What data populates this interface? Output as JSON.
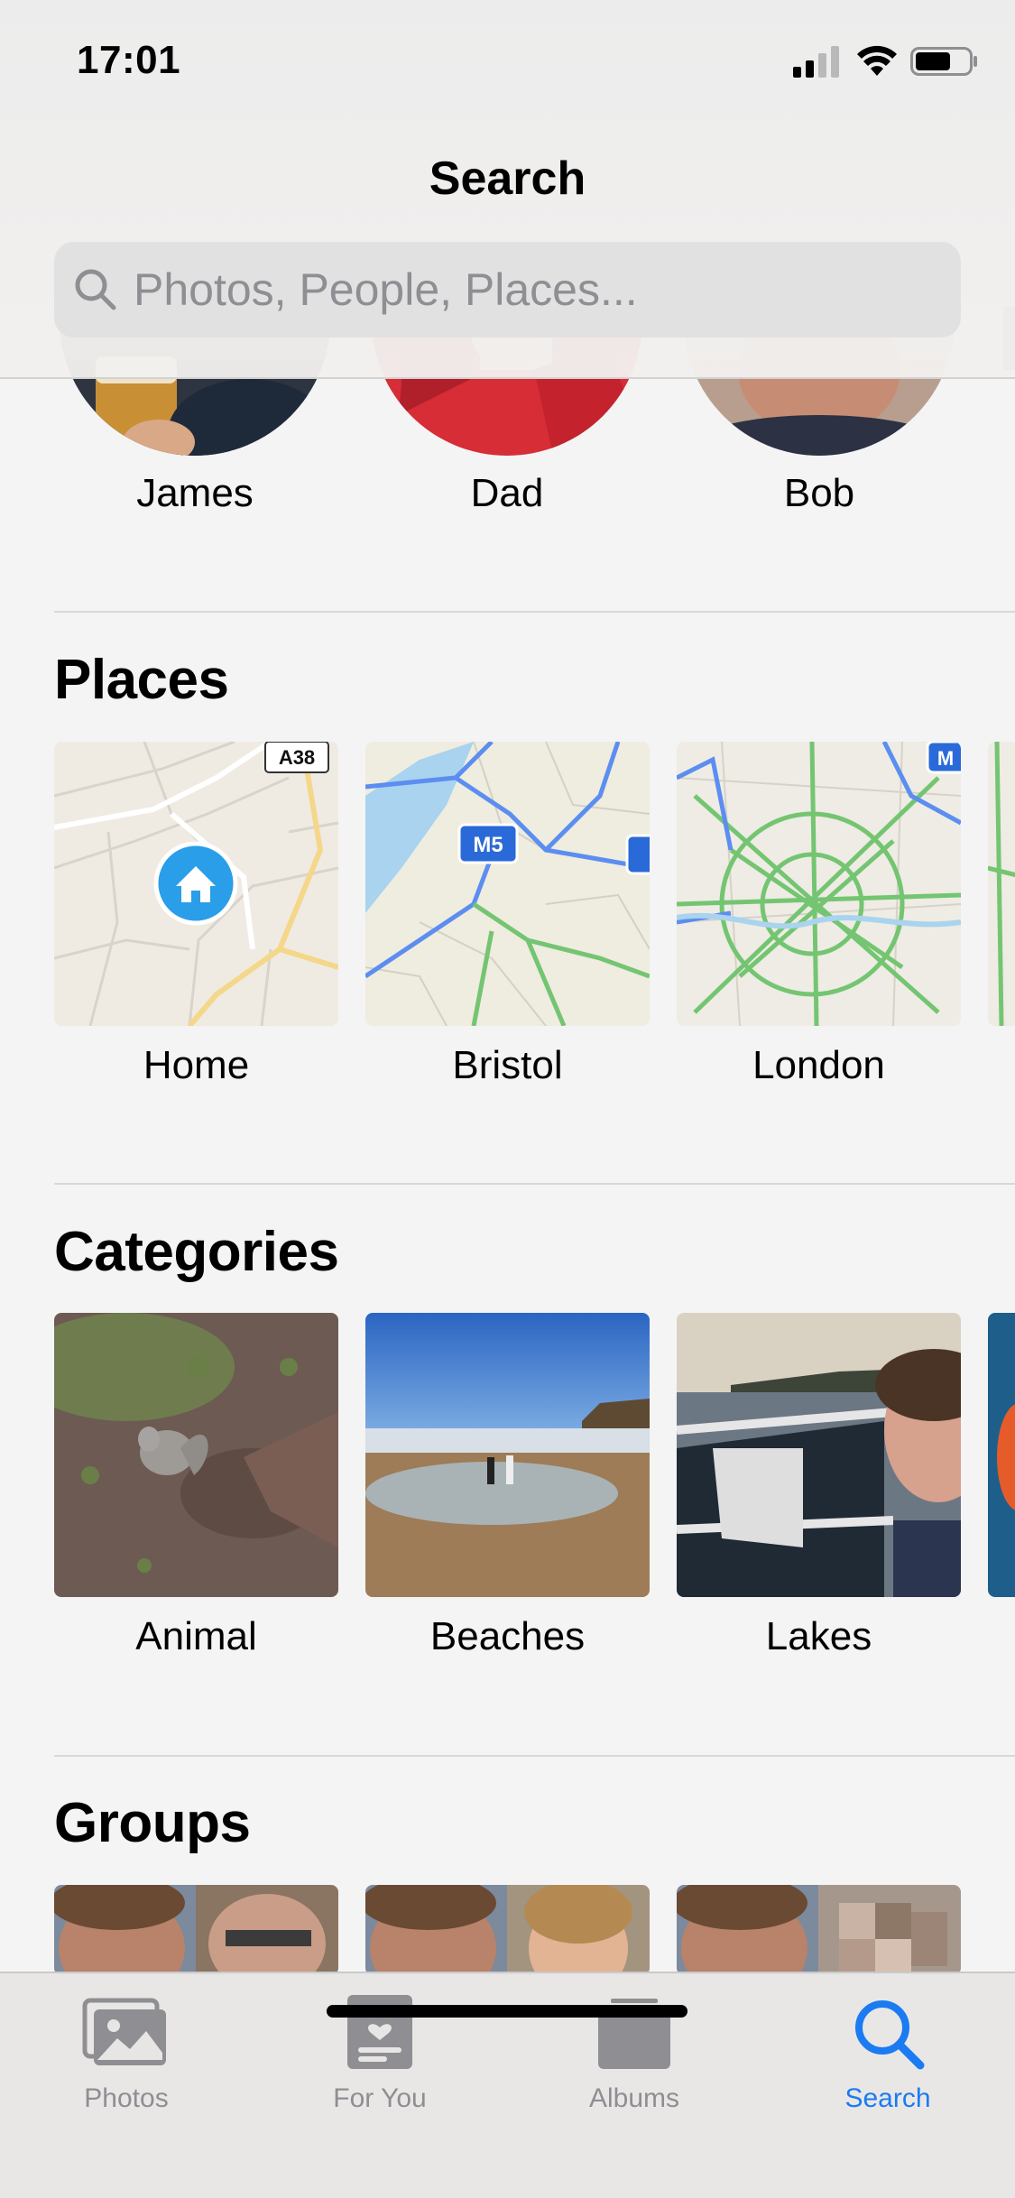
{
  "status_bar": {
    "time": "17:01"
  },
  "header": {
    "title": "Search",
    "search_placeholder": "Photos, People, Places..."
  },
  "people": [
    {
      "name": "James"
    },
    {
      "name": "Dad"
    },
    {
      "name": "Bob"
    }
  ],
  "places": {
    "title": "Places",
    "items": [
      {
        "label": "Home",
        "map_badge": "A38"
      },
      {
        "label": "Bristol",
        "map_badge": "M5"
      },
      {
        "label": "London",
        "map_badge": "M"
      }
    ]
  },
  "categories": {
    "title": "Categories",
    "items": [
      {
        "label": "Animal"
      },
      {
        "label": "Beaches"
      },
      {
        "label": "Lakes"
      }
    ]
  },
  "groups": {
    "title": "Groups"
  },
  "tab_bar": {
    "active": "Search",
    "tabs": [
      {
        "label": "Photos",
        "icon": "photos-icon"
      },
      {
        "label": "For You",
        "icon": "for-you-icon"
      },
      {
        "label": "Albums",
        "icon": "albums-icon"
      },
      {
        "label": "Search",
        "icon": "search-icon"
      }
    ]
  },
  "colors": {
    "accent": "#1b7bf2",
    "inactive_tab": "#8e8e93",
    "background": "#f4f4f5"
  }
}
